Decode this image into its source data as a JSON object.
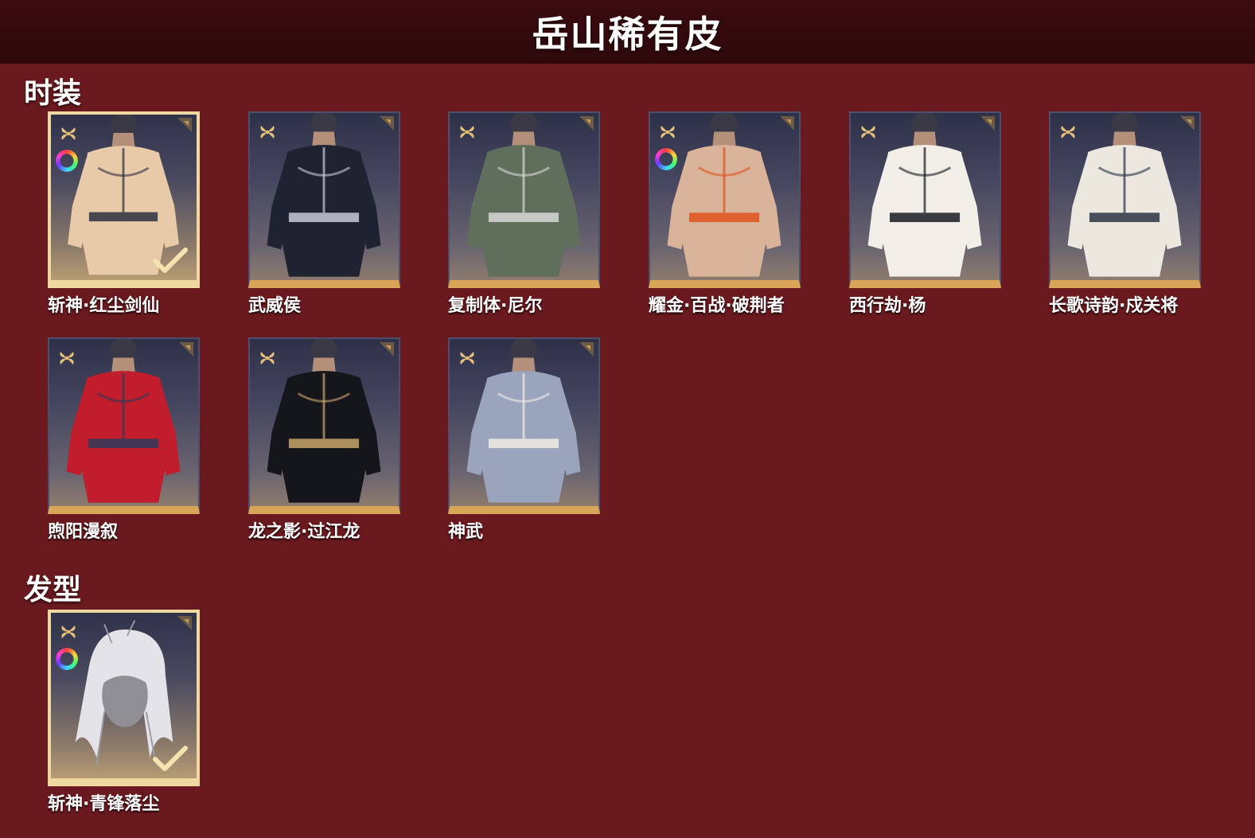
{
  "page": {
    "title": "岳山稀有皮"
  },
  "sections": {
    "costume": {
      "title": "时装",
      "items": [
        {
          "label": "斩神·红尘剑仙",
          "owned": true,
          "dye": true,
          "color": "#e8c9a8",
          "accent": "#2b2f3e"
        },
        {
          "label": "武威侯",
          "owned": false,
          "dye": false,
          "color": "#1f2230",
          "accent": "#c9c9d6"
        },
        {
          "label": "复制体·尼尔",
          "owned": false,
          "dye": false,
          "color": "#5f6f5c",
          "accent": "#d8d8d8"
        },
        {
          "label": "耀金·百战·破荆者",
          "owned": false,
          "dye": true,
          "color": "#d9b39a",
          "accent": "#e0521d"
        },
        {
          "label": "西行劫·杨",
          "owned": false,
          "dye": false,
          "color": "#f1efe8",
          "accent": "#1b1c24"
        },
        {
          "label": "长歌诗韵·戍关将",
          "owned": false,
          "dye": false,
          "color": "#ece8df",
          "accent": "#2a3447"
        },
        {
          "label": "煦阳漫叙",
          "owned": false,
          "dye": false,
          "color": "#c11d2c",
          "accent": "#2e3b59"
        },
        {
          "label": "龙之影·过江龙",
          "owned": false,
          "dye": false,
          "color": "#15161c",
          "accent": "#c8a46a"
        },
        {
          "label": "神武",
          "owned": false,
          "dye": false,
          "color": "#9aa4bd",
          "accent": "#f0ece2"
        }
      ]
    },
    "hairstyle": {
      "title": "发型",
      "items": [
        {
          "label": "斩神·青锋落尘",
          "owned": true,
          "dye": true,
          "color": "#e4e4e8",
          "accent": "#9a9aa4"
        }
      ]
    }
  }
}
